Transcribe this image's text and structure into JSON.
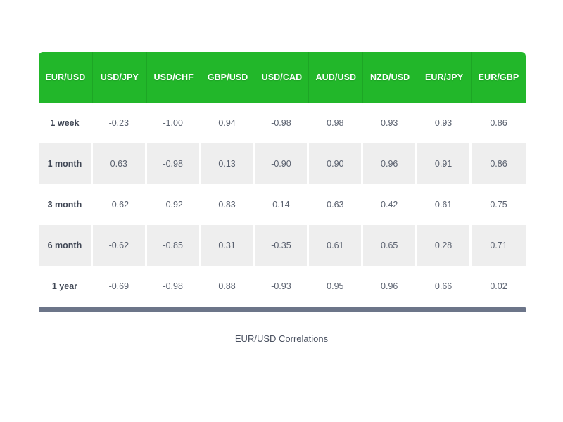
{
  "chart_data": {
    "type": "table",
    "title": "EUR/USD Correlations",
    "caption": "EUR/USD Correlations",
    "columns": [
      "EUR/USD",
      "USD/JPY",
      "USD/CHF",
      "GBP/USD",
      "USD/CAD",
      "AUD/USD",
      "NZD/USD",
      "EUR/JPY",
      "EUR/GBP"
    ],
    "row_label_header": "EUR/USD",
    "pairs": [
      "USD/JPY",
      "USD/CHF",
      "GBP/USD",
      "USD/CAD",
      "AUD/USD",
      "NZD/USD",
      "EUR/JPY",
      "EUR/GBP"
    ],
    "categories": [
      "1 week",
      "1 month",
      "3 month",
      "6 month",
      "1 year"
    ],
    "rows": [
      {
        "label": "1 week",
        "striped": false,
        "values": [
          "-0.23",
          "-1.00",
          "0.94",
          "-0.98",
          "0.98",
          "0.93",
          "0.93",
          "0.86"
        ]
      },
      {
        "label": "1 month",
        "striped": true,
        "values": [
          "0.63",
          "-0.98",
          "0.13",
          "-0.90",
          "0.90",
          "0.96",
          "0.91",
          "0.86"
        ]
      },
      {
        "label": "3 month",
        "striped": false,
        "values": [
          "-0.62",
          "-0.92",
          "0.83",
          "0.14",
          "0.63",
          "0.42",
          "0.61",
          "0.75"
        ]
      },
      {
        "label": "6 month",
        "striped": true,
        "values": [
          "-0.62",
          "-0.85",
          "0.31",
          "-0.35",
          "0.61",
          "0.65",
          "0.28",
          "0.71"
        ]
      },
      {
        "label": "1 year",
        "striped": false,
        "values": [
          "-0.69",
          "-0.98",
          "0.88",
          "-0.93",
          "0.95",
          "0.96",
          "0.66",
          "0.02"
        ]
      }
    ],
    "series": [
      {
        "name": "USD/JPY",
        "values": [
          -0.23,
          0.63,
          -0.62,
          -0.62,
          -0.69
        ]
      },
      {
        "name": "USD/CHF",
        "values": [
          -1.0,
          -0.98,
          -0.92,
          -0.85,
          -0.98
        ]
      },
      {
        "name": "GBP/USD",
        "values": [
          0.94,
          0.13,
          0.83,
          0.31,
          0.88
        ]
      },
      {
        "name": "USD/CAD",
        "values": [
          -0.98,
          -0.9,
          0.14,
          -0.35,
          -0.93
        ]
      },
      {
        "name": "AUD/USD",
        "values": [
          0.98,
          0.9,
          0.63,
          0.61,
          0.95
        ]
      },
      {
        "name": "NZD/USD",
        "values": [
          0.93,
          0.96,
          0.42,
          0.65,
          0.96
        ]
      },
      {
        "name": "EUR/JPY",
        "values": [
          0.93,
          0.91,
          0.61,
          0.28,
          0.66
        ]
      },
      {
        "name": "EUR/GBP",
        "values": [
          0.86,
          0.86,
          0.75,
          0.71,
          0.02
        ]
      }
    ],
    "xlabel": "",
    "ylabel": "",
    "grid": false,
    "legend": "none",
    "colors": {
      "header_background": "#22b72a",
      "header_text": "#ffffff",
      "stripe_background": "#eeeeee",
      "cell_text": "#5b6270",
      "row_label_text": "#3f4654",
      "bottom_bar": "#6c7589",
      "page_background": "#ffffff"
    }
  }
}
